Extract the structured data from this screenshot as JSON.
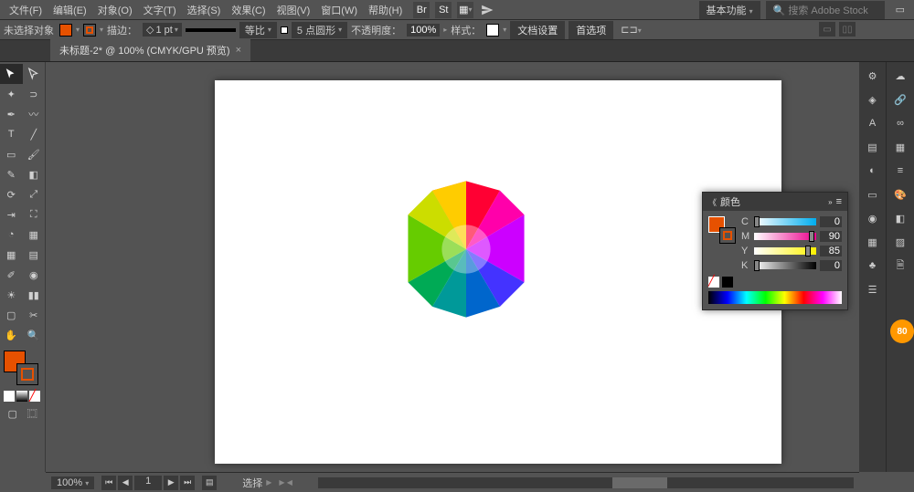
{
  "menu": {
    "file": "文件(F)",
    "edit": "编辑(E)",
    "object": "对象(O)",
    "type": "文字(T)",
    "select": "选择(S)",
    "effect": "效果(C)",
    "view": "视图(V)",
    "window": "窗口(W)",
    "help": "帮助(H)"
  },
  "header": {
    "br": "Br",
    "st": "St",
    "workspace": "基本功能",
    "search_placeholder": "搜索 Adobe Stock"
  },
  "control": {
    "no_selection": "未选择对象",
    "fill_color": "#e65100",
    "stroke_color": "#e65100",
    "stroke_label": "描边：",
    "stroke_width": "1 pt",
    "ratio": "等比",
    "brush_style": "5 点圆形",
    "opacity_label": "不透明度：",
    "opacity_value": "100%",
    "style_label": "样式：",
    "doc_setup": "文档设置",
    "preferences": "首选项"
  },
  "tab": {
    "title": "未标题-2* @ 100% (CMYK/GPU 预览)"
  },
  "color_panel": {
    "title": "颜色",
    "channels": {
      "c": {
        "label": "C",
        "value": "0"
      },
      "m": {
        "label": "M",
        "value": "90"
      },
      "y": {
        "label": "Y",
        "value": "85"
      },
      "k": {
        "label": "K",
        "value": "0"
      }
    }
  },
  "status": {
    "zoom": "100%",
    "page": "1",
    "selection": "选择"
  },
  "badge": "80"
}
